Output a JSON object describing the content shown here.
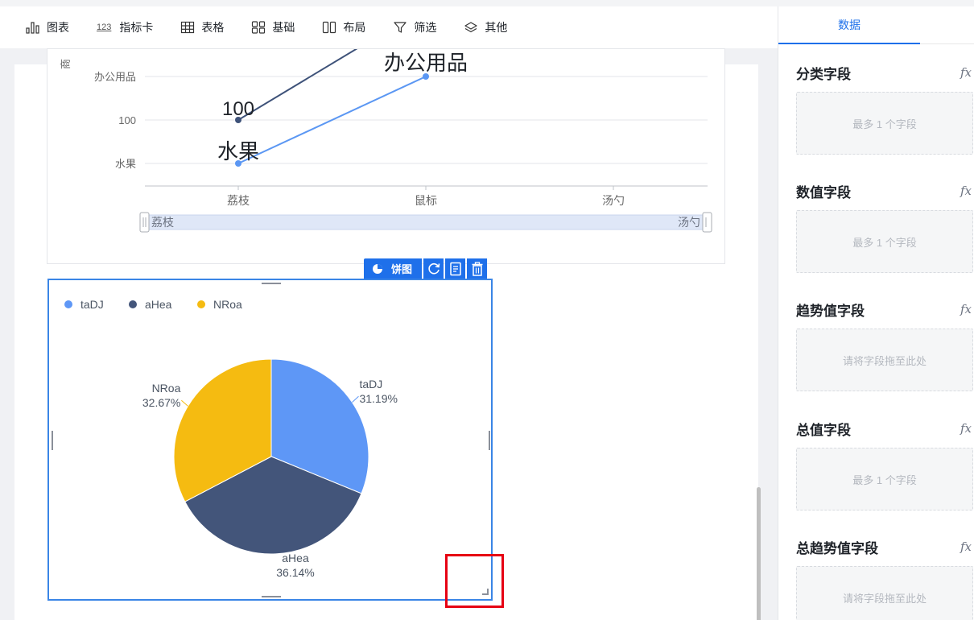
{
  "toolbar": {
    "items": [
      {
        "label": "图表",
        "icon": "bar-chart-icon"
      },
      {
        "label": "指标卡",
        "icon": "number-card-icon",
        "icon_text": "123"
      },
      {
        "label": "表格",
        "icon": "table-icon"
      },
      {
        "label": "基础",
        "icon": "basic-components-icon"
      },
      {
        "label": "布局",
        "icon": "layout-icon"
      },
      {
        "label": "筛选",
        "icon": "filter-icon"
      },
      {
        "label": "其他",
        "icon": "layers-icon"
      }
    ]
  },
  "line_chart": {
    "y_tick_labels": [
      "办公用品",
      "100",
      "水果"
    ],
    "y_axis_title_partial": "商",
    "x_tick_labels": [
      "荔枝",
      "鼠标",
      "汤勺"
    ],
    "data_labels": {
      "dark_series_point": "100",
      "light_series_point": "水果",
      "light_series_top": "办公用品"
    },
    "slider": {
      "start_label": "荔枝",
      "end_label": "汤勺"
    },
    "colors": {
      "dark": "#3e5279",
      "light": "#5b97f3"
    }
  },
  "pie_toolbar": {
    "type_label": "饼图",
    "actions": [
      "refresh-icon",
      "data-sheet-icon",
      "trash-icon"
    ]
  },
  "chart_data": {
    "type": "pie",
    "legend_position": "top-left",
    "slices": [
      {
        "name": "taDJ",
        "value": 31.19,
        "label": "31.19%",
        "color": "#5e97f6"
      },
      {
        "name": "aHea",
        "value": 36.14,
        "label": "36.14%",
        "color": "#43557a"
      },
      {
        "name": "NRoa",
        "value": 32.67,
        "label": "32.67%",
        "color": "#f5bb11"
      }
    ]
  },
  "panel": {
    "tab_label": "数据",
    "groups": [
      {
        "title": "分类字段",
        "placeholder": "最多 1 个字段"
      },
      {
        "title": "数值字段",
        "placeholder": "最多 1 个字段"
      },
      {
        "title": "趋势值字段",
        "placeholder": "请将字段拖至此处"
      },
      {
        "title": "总值字段",
        "placeholder": "最多 1 个字段"
      },
      {
        "title": "总趋势值字段",
        "placeholder": "请将字段拖至此处"
      }
    ],
    "fx_label": "fx"
  }
}
